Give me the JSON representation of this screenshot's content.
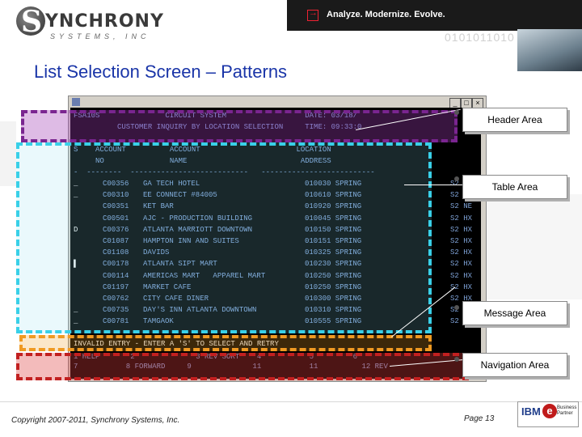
{
  "brand": {
    "logo_letter": "S",
    "logo_word": "YNCHRONY",
    "logo_sub": "SYSTEMS, INC",
    "tagline": "Analyze. Modernize. Evolve.",
    "binary": "0101011010"
  },
  "slide": {
    "title": "List Selection Screen – Patterns",
    "copyright": "Copyright 2007-2011, Synchrony Systems, Inc.",
    "page": "Page 13"
  },
  "partner": {
    "ibm": "IBM",
    "e": "e",
    "label": "Business\nPartner"
  },
  "terminal": {
    "window_buttons": [
      "_",
      "□",
      "×"
    ],
    "header_lines": [
      "FSA10S               CIRCUIT SYSTEM                  DATE: 03/18/",
      "          CUSTOMER INQUIRY BY LOCATION SELECTION     TIME: 09:33:0"
    ],
    "column_lines": [
      "S    ACCOUNT          ACCOUNT                      LOCATION",
      "     NO               NAME                          ADDRESS",
      "-  --------  ---------------------------   --------------------------"
    ],
    "rows": [
      {
        "sel": "_",
        "acct": "C00356",
        "name": "GA TECH HOTEL",
        "addr": "010030 SPRING",
        "tail": "S2 HX"
      },
      {
        "sel": "_",
        "acct": "C00310",
        "name": "EE CONNECT #84005",
        "addr": "010610 SPRING",
        "tail": "S2 HX"
      },
      {
        "sel": "",
        "acct": "C00351",
        "name": "KET BAR",
        "addr": "010920 SPRING",
        "tail": "S2 NE"
      },
      {
        "sel": "",
        "acct": "C00501",
        "name": "AJC - PRODUCTION BUILDING",
        "addr": "010045 SPRING",
        "tail": "S2 HX"
      },
      {
        "sel": "D",
        "acct": "C00376",
        "name": "ATLANTA MARRIOTT DOWNTOWN",
        "addr": "010150 SPRING",
        "tail": "S2 HX"
      },
      {
        "sel": "",
        "acct": "C01087",
        "name": "HAMPTON INN AND SUITES",
        "addr": "010151 SPRING",
        "tail": "S2 HX"
      },
      {
        "sel": "",
        "acct": "C01108",
        "name": "DAVIDS",
        "addr": "010325 SPRING",
        "tail": "S2 HX"
      },
      {
        "sel": "▌",
        "acct": "C00178",
        "name": "ATLANTA SIPT MART",
        "addr": "010230 SPRING",
        "tail": "S2 HX"
      },
      {
        "sel": "",
        "acct": "C00114",
        "name": "AMERICAS MART   APPAREL MART",
        "addr": "010250 SPRING",
        "tail": "S2 HX"
      },
      {
        "sel": "",
        "acct": "C01197",
        "name": "MARKET CAFE",
        "addr": "010250 SPRING",
        "tail": "S2 HX"
      },
      {
        "sel": "",
        "acct": "C00762",
        "name": "CITY CAFE DINER",
        "addr": "010300 SPRING",
        "tail": "S2 HX"
      },
      {
        "sel": "_",
        "acct": "C00735",
        "name": "DAY'S INN ATLANTA DOWNTOWN",
        "addr": "010310 SPRING",
        "tail": "S2 HX"
      },
      {
        "sel": "_",
        "acct": "C00781",
        "name": "TAMGAOK",
        "addr": "010555 SPRING",
        "tail": "S2 HX"
      }
    ],
    "message": "INVALID ENTRY - ENTER A 'S' TO SELECT AND RETRY",
    "nav_lines": [
      "1 HELP       2              3 REV SORT    4           5         6",
      "7           8 FORWARD     9              11           11          12 REV"
    ]
  },
  "callouts": {
    "header": "Header Area",
    "table": "Table Area",
    "message": "Message Area",
    "navigation": "Navigation Area"
  },
  "colors": {
    "title": "#1a35a8",
    "header_box": "#7a2590",
    "table_box": "#39d0e8",
    "message_box": "#f09a22",
    "navigation_box": "#c22020"
  }
}
